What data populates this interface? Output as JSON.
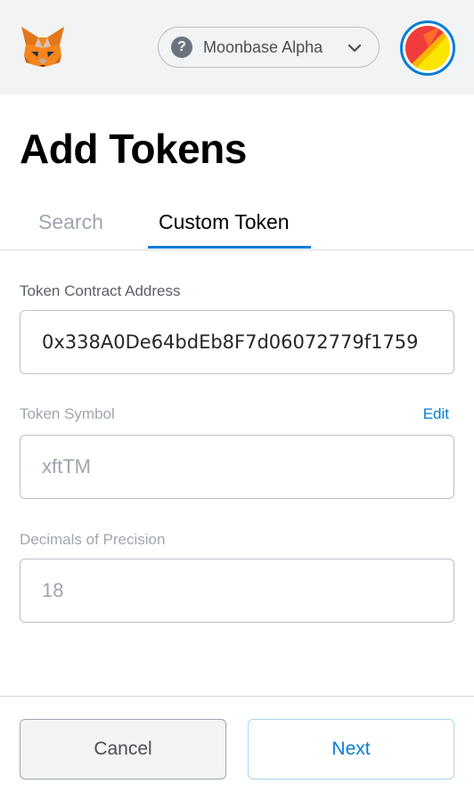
{
  "header": {
    "logo_icon": "metamask-fox-icon",
    "network": {
      "label": "Moonbase Alpha",
      "help_icon": "question-circle-icon",
      "chevron_icon": "chevron-down-icon"
    },
    "account_icon": "account-identicon",
    "accent_color": "#037dd6"
  },
  "page": {
    "title": "Add Tokens"
  },
  "tabs": [
    {
      "label": "Search",
      "active": false
    },
    {
      "label": "Custom Token",
      "active": true
    }
  ],
  "form": {
    "contract_address": {
      "label": "Token Contract Address",
      "value": "0x338A0De64bdEb8F7d06072779f1759"
    },
    "token_symbol": {
      "label": "Token Symbol",
      "edit_label": "Edit",
      "value": "xftTM"
    },
    "decimals": {
      "label": "Decimals of Precision",
      "value": "18"
    }
  },
  "footer": {
    "cancel_label": "Cancel",
    "next_label": "Next"
  }
}
